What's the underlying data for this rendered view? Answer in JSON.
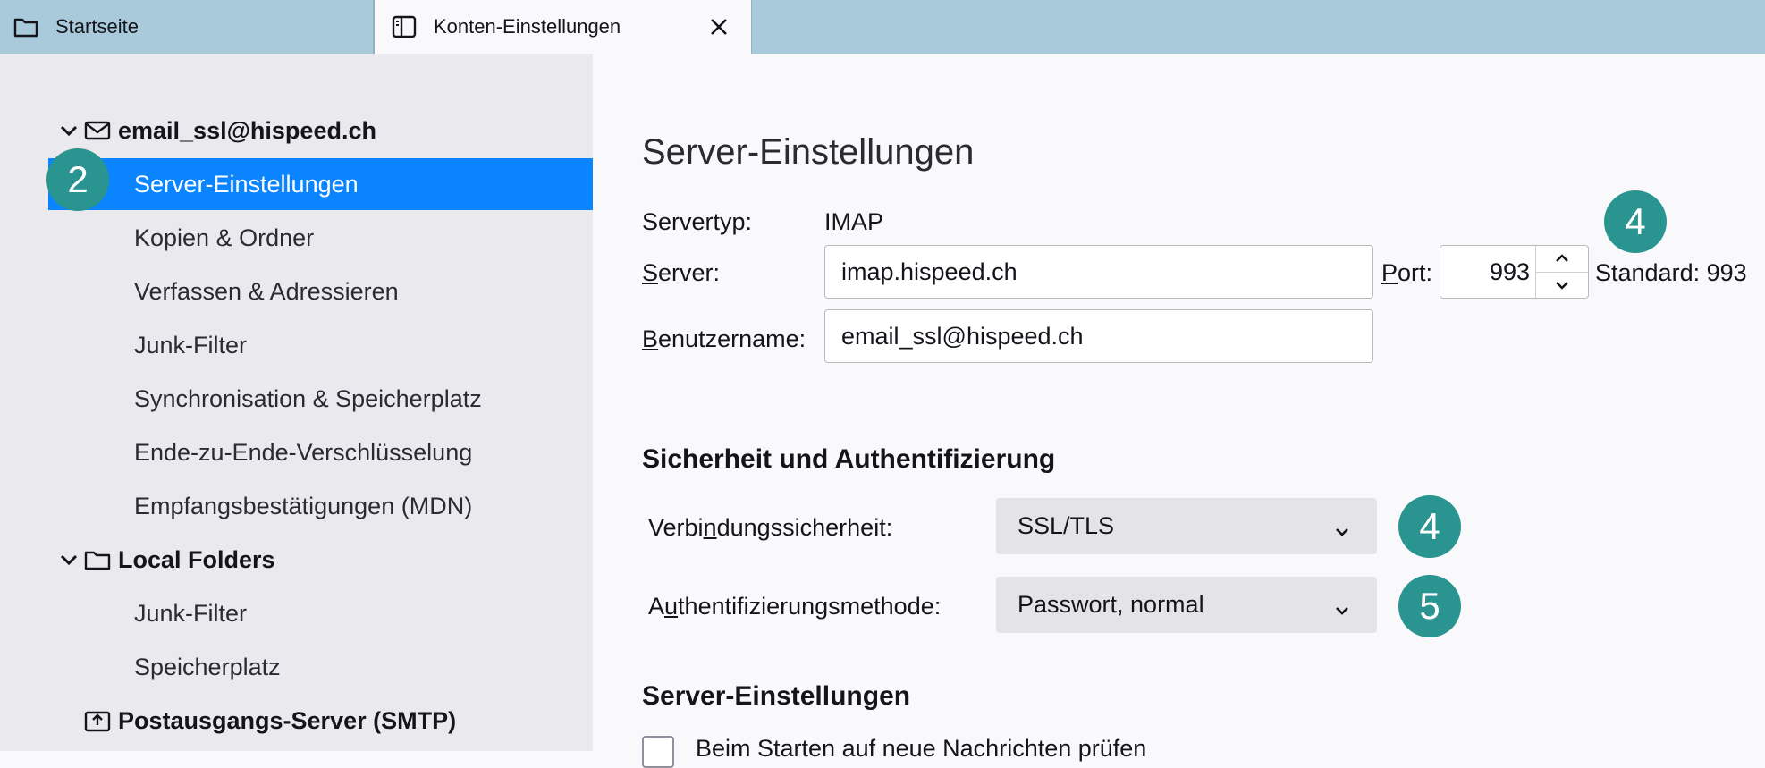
{
  "tabs": [
    {
      "label": "Startseite",
      "icon": "folder-icon",
      "active": false
    },
    {
      "label": "Konten-Einstellungen",
      "icon": "settings-tab-icon",
      "active": true
    }
  ],
  "sidebar": {
    "accounts": [
      {
        "label": "email_ssl@hispeed.ch",
        "icon": "mail-icon",
        "items": [
          "Server-Einstellungen",
          "Kopien & Ordner",
          "Verfassen & Adressieren",
          "Junk-Filter",
          "Synchronisation & Speicherplatz",
          "Ende-zu-Ende-Verschlüsselung",
          "Empfangsbestätigungen (MDN)"
        ],
        "selected_index": 0
      },
      {
        "label": "Local Folders",
        "icon": "folder-icon",
        "items": [
          "Junk-Filter",
          "Speicherplatz"
        ]
      },
      {
        "label": "Postausgangs-Server (SMTP)",
        "icon": "outbox-icon",
        "items": []
      }
    ]
  },
  "badges": {
    "sidebar": "2",
    "port": "4",
    "security": "4",
    "auth": "5"
  },
  "main": {
    "title": "Server-Einstellungen",
    "servertype_label": "Servertyp:",
    "servertype_value": "IMAP",
    "server_label_u": "S",
    "server_label_rest": "erver:",
    "server_value": "imap.hispeed.ch",
    "port_label_u": "P",
    "port_label_rest": "ort:",
    "port_value": "993",
    "port_default": "Standard: 993",
    "username_label_u": "B",
    "username_label_rest": "enutzername:",
    "username_value": "email_ssl@hispeed.ch",
    "security_heading": "Sicherheit und Authentifizierung",
    "conn_label_a": "Verbi",
    "conn_label_u": "n",
    "conn_label_b": "dungssicherheit:",
    "conn_value": "SSL/TLS",
    "auth_label_a": "A",
    "auth_label_u": "u",
    "auth_label_b": "thentifizierungsmethode:",
    "auth_value": "Passwort, normal",
    "server_settings_heading": "Server-Einstellungen",
    "checkbox_partial_text": "Beim Starten auf neue Nachrichten prüfen"
  },
  "colors": {
    "accent": "#0a84ff",
    "badge": "#2a9490",
    "tabbar": "#a9cadb",
    "sidebar": "#eaeaee"
  }
}
